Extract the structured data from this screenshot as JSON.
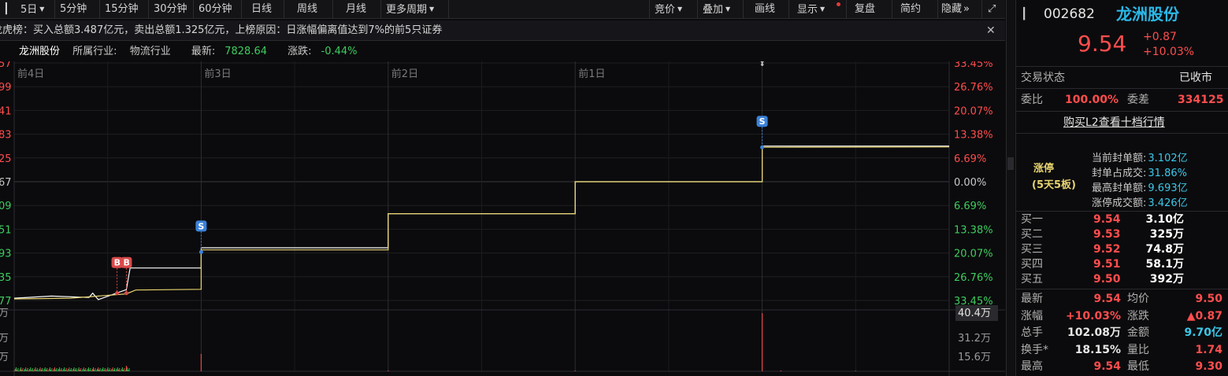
{
  "toolbar": {
    "left": [
      "5日",
      "5分钟",
      "15分钟",
      "30分钟",
      "60分钟",
      "日线",
      "周线",
      "月线",
      "更多周期"
    ],
    "right": [
      "竞价",
      "叠加",
      "画线",
      "显示",
      "复盘",
      "简约",
      "隐藏"
    ],
    "collapse_glyph": "»",
    "expand_glyph": "⤢"
  },
  "notice": {
    "text": "龙虎榜：买入总额3.487亿元，卖出总额1.325亿元，上榜原因：日涨幅偏离值达到7%的前5只证券",
    "close": "✕"
  },
  "info": {
    "name": "龙洲股份",
    "industry_label": "所属行业:",
    "industry": "物流行业",
    "latest_label": "最新:",
    "latest": "7828.64",
    "change_label": "涨跌:",
    "change": "-0.44%"
  },
  "chart_data": {
    "type": "line",
    "title": "",
    "days": [
      "前4日",
      "前3日",
      "前2日",
      "前1日",
      ""
    ],
    "pct_ticks": [
      "33.45%",
      "26.76%",
      "20.07%",
      "13.38%",
      "6.69%",
      "0.00%",
      "6.69%",
      "13.38%",
      "20.07%",
      "26.76%",
      "33.45%"
    ],
    "left_ticks": [
      "57",
      "99",
      "41",
      "83",
      "25",
      "67",
      "09",
      "51",
      "93",
      "35",
      "77"
    ],
    "ylim_pct": [
      -33.45,
      33.45
    ],
    "series": [
      {
        "values": [
          [
            0,
            -32.8
          ],
          [
            0.2,
            -32.2
          ],
          [
            0.4,
            -32.6
          ],
          [
            0.42,
            -31.4
          ],
          [
            0.45,
            -33.2
          ],
          [
            0.6,
            -30.4
          ],
          [
            0.62,
            -24.3
          ],
          [
            1.0,
            -24.3
          ],
          [
            1.0,
            -18.6
          ],
          [
            2.0,
            -18.6
          ],
          [
            2.0,
            -9.0
          ],
          [
            3.0,
            -9.0
          ],
          [
            3.0,
            0.0
          ],
          [
            4.0,
            0.0
          ],
          [
            4.0,
            10.03
          ],
          [
            5.0,
            10.03
          ]
        ]
      },
      {
        "values": [
          [
            0.0,
            -33.0
          ],
          [
            0.3,
            -32.8
          ],
          [
            0.6,
            -31.6
          ],
          [
            0.65,
            -30.5
          ],
          [
            1.0,
            -30.3
          ],
          [
            1.0,
            -19.2
          ],
          [
            2.0,
            -19.2
          ],
          [
            2.0,
            -9.0
          ],
          [
            3.0,
            -9.0
          ],
          [
            3.0,
            0.0
          ],
          [
            4.0,
            0.0
          ],
          [
            4.0,
            9.7
          ],
          [
            5.0,
            9.8
          ]
        ]
      }
    ],
    "markers": [
      {
        "label": "B",
        "x": 0.55,
        "y": -31.4
      },
      {
        "label": "B",
        "x": 0.6,
        "y": -31.4
      },
      {
        "label": "S",
        "x": 1.0,
        "y": -19.8
      },
      {
        "label": "S",
        "x": 4.0,
        "y": 9.7
      }
    ],
    "volume": {
      "ticks": [
        "40.4万",
        "31.2万",
        "15.6万"
      ],
      "unit": "万",
      "ymax": 40.4,
      "spikes": [
        {
          "x": 0.42,
          "v": 1.2
        },
        {
          "x": 0.45,
          "v": 1.5
        },
        {
          "x": 0.6,
          "v": 3.8
        },
        {
          "x": 1.0,
          "v": 12.1
        },
        {
          "x": 2.0,
          "v": 0.6
        },
        {
          "x": 3.0,
          "v": 0.5
        },
        {
          "x": 4.0,
          "v": 40.4
        },
        {
          "x": 4.1,
          "v": 0.6
        },
        {
          "x": 4.5,
          "v": 0.4
        }
      ]
    }
  },
  "quote": {
    "code": "002682",
    "name": "龙洲股份",
    "price": "9.54",
    "change": "+0.87",
    "pct": "+10.03%",
    "status_label": "交易状态",
    "status": "已收市",
    "ratio_label": "委比",
    "ratio": "100.00%",
    "diff_label": "委差",
    "diff": "334125",
    "l2_link": "购买L2查看十档行情",
    "limit_title": "涨停",
    "limit_sub": "(5天5板)",
    "limit_rows": [
      {
        "label": "当前封单额:",
        "value": "3.102亿"
      },
      {
        "label": "封单占成交:",
        "value": "31.86%"
      },
      {
        "label": "最高封单额:",
        "value": "9.693亿"
      },
      {
        "label": "涨停成交额:",
        "value": "3.426亿"
      }
    ],
    "bids": [
      {
        "label": "买一",
        "price": "9.54",
        "vol": "3.10亿"
      },
      {
        "label": "买二",
        "price": "9.53",
        "vol": "325万"
      },
      {
        "label": "买三",
        "price": "9.52",
        "vol": "74.8万"
      },
      {
        "label": "买四",
        "price": "9.51",
        "vol": "58.1万"
      },
      {
        "label": "买五",
        "price": "9.50",
        "vol": "392万"
      }
    ],
    "stats": [
      [
        {
          "label": "最新",
          "value": "9.54",
          "color": "#ff4d4d"
        },
        {
          "label": "均价",
          "value": "9.50",
          "color": "#ff4d4d"
        }
      ],
      [
        {
          "label": "涨幅",
          "value": "+10.03%",
          "color": "#ff4d4d"
        },
        {
          "label": "涨跌",
          "value": "▲0.87",
          "color": "#ff4d4d"
        }
      ],
      [
        {
          "label": "总手",
          "value": "102.08万",
          "color": "#e6e6e6"
        },
        {
          "label": "金额",
          "value": "9.70亿",
          "color": "#3ec7e8"
        }
      ],
      [
        {
          "label": "换手*",
          "value": "18.15%",
          "color": "#e6e6e6"
        },
        {
          "label": "量比",
          "value": "1.74",
          "color": "#ff4d4d"
        }
      ],
      [
        {
          "label": "最高",
          "value": "9.54",
          "color": "#ff4d4d"
        },
        {
          "label": "最低",
          "value": "9.30",
          "color": "#ff4d4d"
        }
      ]
    ]
  },
  "colors": {
    "up": "#ff4d4d",
    "down": "#3ecc5e",
    "price_line": "#ffffff",
    "avg_line": "#e8d470",
    "name": "#2ab8e8",
    "vol_up": "#e04848",
    "vol_down": "#35c14e",
    "marker_b": "#d94a4a",
    "marker_s": "#3b82d9"
  }
}
